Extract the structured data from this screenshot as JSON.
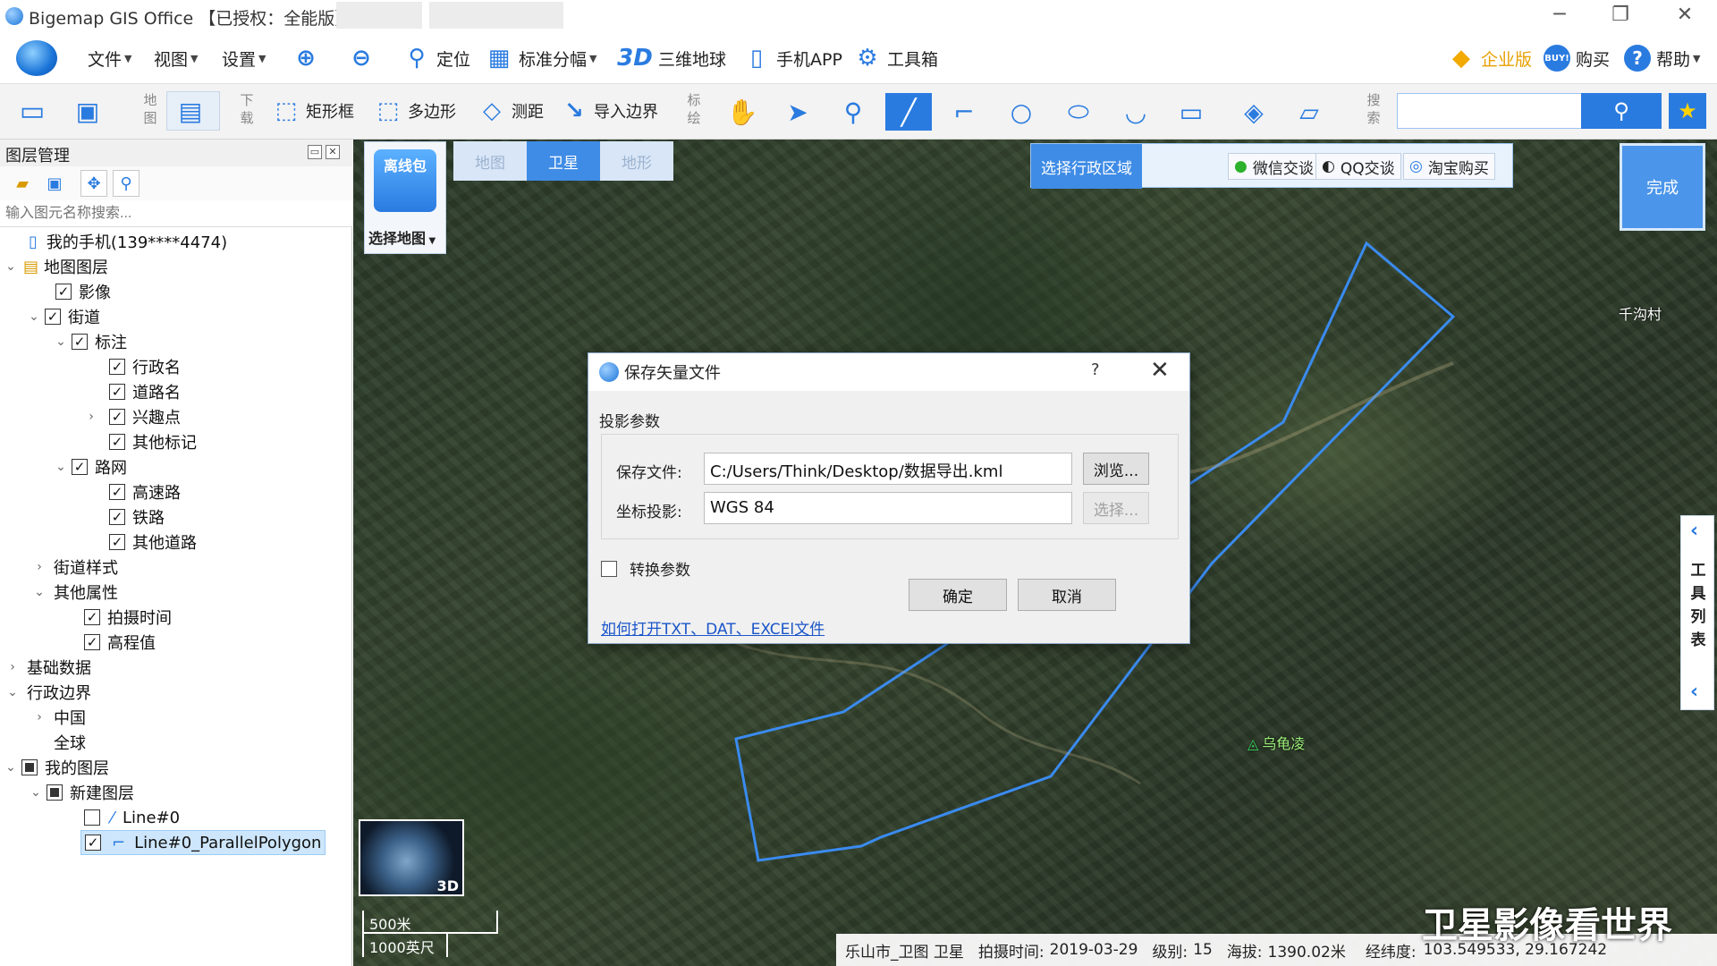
{
  "window": {
    "title": "Bigemap GIS Office 【已授权：全能版】",
    "minimize": "─",
    "restore": "❐",
    "close": "✕"
  },
  "toolbar": {
    "file": "文件",
    "view": "视图",
    "settings": "设置",
    "locate": "定位",
    "grid": "标准分幅",
    "three_d_badge": "3D",
    "earth3d": "三维地球",
    "mobile": "手机APP",
    "toolbox": "工具箱",
    "enterprise": "企业版",
    "buy_badge": "BUY!",
    "buy": "购买",
    "help": "帮助"
  },
  "toolbar2": {
    "map_label": "地图",
    "download_label": "下载",
    "rect": "矩形框",
    "polygon": "多边形",
    "measure": "测距",
    "import_boundary": "导入边界",
    "draw_label": "标绘",
    "search_label": "搜索",
    "search_placeholder": ""
  },
  "layer_panel": {
    "title": "图层管理",
    "search_placeholder": "输入图元名称搜索...",
    "items": [
      {
        "label": "我的手机(139****4474)"
      },
      {
        "label": "地图图层"
      },
      {
        "label": "影像"
      },
      {
        "label": "街道"
      },
      {
        "label": "标注"
      },
      {
        "label": "行政名"
      },
      {
        "label": "道路名"
      },
      {
        "label": "兴趣点"
      },
      {
        "label": "其他标记"
      },
      {
        "label": "路网"
      },
      {
        "label": "高速路"
      },
      {
        "label": "铁路"
      },
      {
        "label": "其他道路"
      },
      {
        "label": "街道样式"
      },
      {
        "label": "其他属性"
      },
      {
        "label": "拍摄时间"
      },
      {
        "label": "高程值"
      },
      {
        "label": "基础数据"
      },
      {
        "label": "行政边界"
      },
      {
        "label": "中国"
      },
      {
        "label": "全球"
      },
      {
        "label": "我的图层"
      },
      {
        "label": "新建图层"
      },
      {
        "label": "Line#0"
      },
      {
        "label": "Line#0_ParallelPolygon"
      }
    ]
  },
  "map": {
    "types": [
      "地图",
      "卫星",
      "地形"
    ],
    "active_type": "卫星",
    "select_map": "选择地图",
    "package_badge": "离线包",
    "region": "选择行政区域",
    "wechat": "微信交谈",
    "qq": "QQ交谈",
    "taobao": "淘宝购买",
    "done": "完成",
    "tool_list": "工具列表",
    "places": [
      "千沟村",
      "乌龟凌"
    ],
    "globe_label": "3D",
    "scale_metric": "500米",
    "scale_imperial": "1000英尺",
    "status": {
      "location": "乐山市_卫图 卫星",
      "capture_time_label": "拍摄时间:",
      "capture_time": "2019-03-29",
      "level_label": "级别:",
      "level": "15",
      "altitude_label": "海拔:",
      "altitude": "1390.02米",
      "coords_label": "经纬度:",
      "coords": "103.549533, 29.167242"
    },
    "watermark": "卫星影像看世界"
  },
  "dialog": {
    "title": "保存矢量文件",
    "help": "?",
    "close": "✕",
    "section": "投影参数",
    "file_label": "保存文件:",
    "file_value": "C:/Users/Think/Desktop/数据导出.kml",
    "browse": "浏览...",
    "proj_label": "坐标投影:",
    "proj_value": "WGS 84",
    "choose": "选择...",
    "convert": "转换参数",
    "ok": "确定",
    "cancel": "取消",
    "link": "如何打开TXT、DAT、EXCEl文件"
  }
}
